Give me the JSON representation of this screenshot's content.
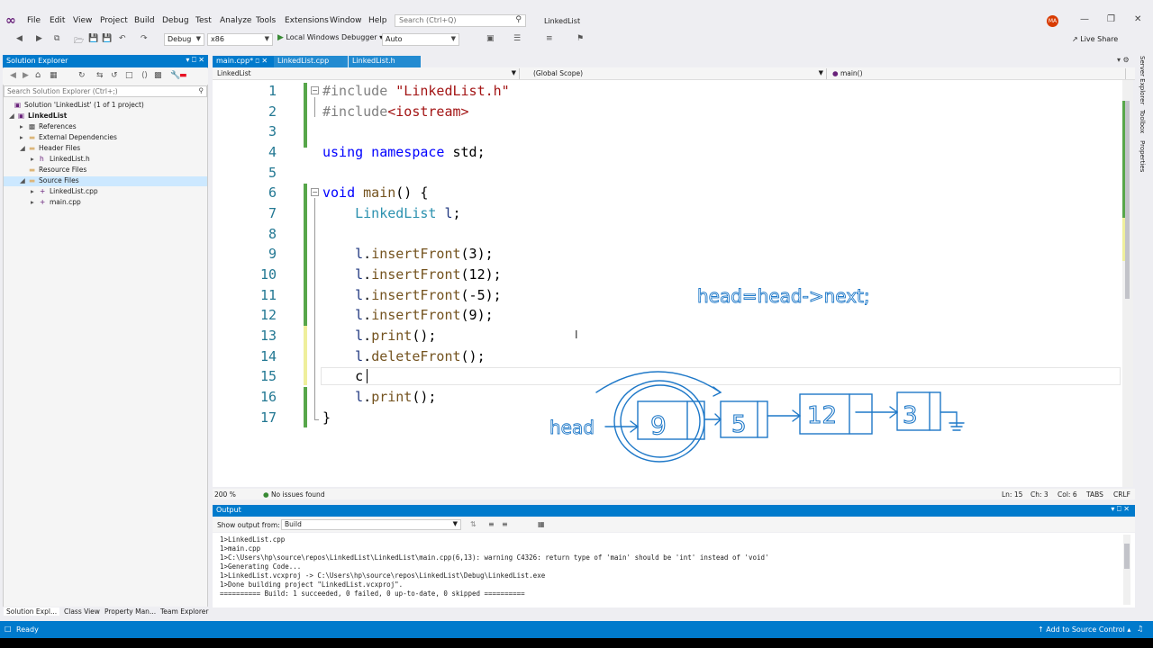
{
  "menu": [
    "File",
    "Edit",
    "View",
    "Project",
    "Build",
    "Debug",
    "Test",
    "Analyze",
    "Tools",
    "Extensions",
    "Window",
    "Help"
  ],
  "search": {
    "placeholder": "Search (Ctrl+Q)"
  },
  "solution_title": "LinkedList",
  "user_initials": "MA",
  "toolbar": {
    "config": "Debug",
    "platform": "x86",
    "run_label": "Local Windows Debugger",
    "run_mode": "Auto",
    "live_share": "Live Share"
  },
  "solution_explorer": {
    "title": "Solution Explorer",
    "search_placeholder": "Search Solution Explorer (Ctrl+;)",
    "items": [
      {
        "label": "Solution 'LinkedList' (1 of 1 project)",
        "icon": "solution-icon"
      },
      {
        "label": "LinkedList",
        "icon": "project-icon"
      },
      {
        "label": "References",
        "icon": "references-icon"
      },
      {
        "label": "External Dependencies",
        "icon": "folder-icon"
      },
      {
        "label": "Header Files",
        "icon": "folder-icon"
      },
      {
        "label": "LinkedList.h",
        "icon": "header-file-icon"
      },
      {
        "label": "Resource Files",
        "icon": "folder-icon"
      },
      {
        "label": "Source Files",
        "icon": "folder-icon"
      },
      {
        "label": "LinkedList.cpp",
        "icon": "cpp-file-icon"
      },
      {
        "label": "main.cpp",
        "icon": "cpp-file-icon"
      }
    ]
  },
  "bottom_tabs": [
    "Solution Expl...",
    "Class View",
    "Property Man...",
    "Team Explorer"
  ],
  "doc_tabs": [
    "main.cpp*",
    "LinkedList.cpp",
    "LinkedList.h"
  ],
  "navbar": {
    "project": "LinkedList",
    "scope": "(Global Scope)",
    "member": "main()"
  },
  "code_lines": [
    "1",
    "2",
    "3",
    "4",
    "5",
    "6",
    "7",
    "8",
    "9",
    "10",
    "11",
    "12",
    "13",
    "14",
    "15",
    "16",
    "17"
  ],
  "annotations": {
    "note": "head=head->next;",
    "head": "head",
    "n1": "9",
    "n2": "5",
    "n3": "12",
    "n4": "3"
  },
  "editor_status": {
    "zoom": "200 %",
    "issues": "No issues found",
    "ln": "Ln: 15",
    "ch": "Ch: 3",
    "col": "Col: 6",
    "tabs": "TABS",
    "eol": "CRLF"
  },
  "right_strip": [
    "Server Explorer",
    "Toolbox",
    "Properties"
  ],
  "output": {
    "title": "Output",
    "show_from": "Show output from:",
    "source": "Build",
    "lines": [
      "1>LinkedList.cpp",
      "1>main.cpp",
      "1>C:\\Users\\hp\\source\\repos\\LinkedList\\LinkedList\\main.cpp(6,13): warning C4326: return type of 'main' should be 'int' instead of 'void'",
      "1>Generating Code...",
      "1>LinkedList.vcxproj -> C:\\Users\\hp\\source\\repos\\LinkedList\\Debug\\LinkedList.exe",
      "1>Done building project \"LinkedList.vcxproj\".",
      "========== Build: 1 succeeded, 0 failed, 0 up-to-date, 0 skipped =========="
    ]
  },
  "status": {
    "ready": "Ready",
    "source_control": "Add to Source Control"
  }
}
